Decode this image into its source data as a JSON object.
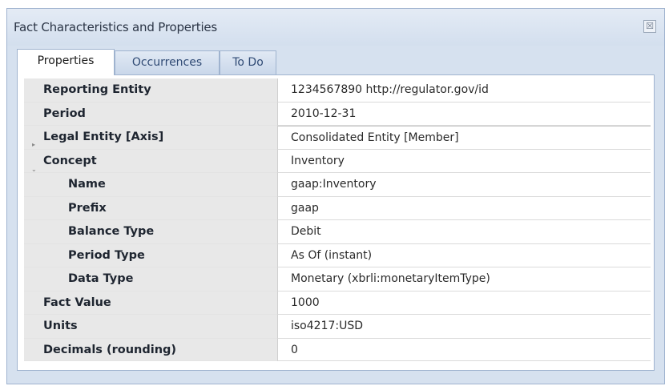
{
  "panel": {
    "title": "Fact Characteristics and Properties",
    "close_glyph": "☒"
  },
  "tabs": [
    {
      "label": "Properties",
      "active": true
    },
    {
      "label": "Occurrences",
      "active": false
    },
    {
      "label": "To Do",
      "active": false
    }
  ],
  "properties": [
    {
      "name": "Reporting Entity",
      "value": "1234567890 http://regulator.gov/id"
    },
    {
      "name": "Period",
      "value": "2010-12-31"
    },
    {
      "name": "Legal Entity [Axis]",
      "value": "Consolidated Entity [Member]",
      "expander": "collapsed"
    },
    {
      "name": "Concept",
      "value": "Inventory",
      "expander": "expanded"
    },
    {
      "name": "Name",
      "value": "gaap:Inventory"
    },
    {
      "name": "Prefix",
      "value": "gaap"
    },
    {
      "name": "Balance Type",
      "value": "Debit"
    },
    {
      "name": "Period Type",
      "value": "As Of (instant)"
    },
    {
      "name": "Data Type",
      "value": "Monetary (xbrli:monetaryItemType)"
    },
    {
      "name": "Fact Value",
      "value": "1000"
    },
    {
      "name": "Units",
      "value": "iso4217:USD"
    },
    {
      "name": "Decimals (rounding)",
      "value": "0"
    }
  ],
  "icons": {
    "expand_collapsed": "▸",
    "expand_expanded": "⌄"
  }
}
